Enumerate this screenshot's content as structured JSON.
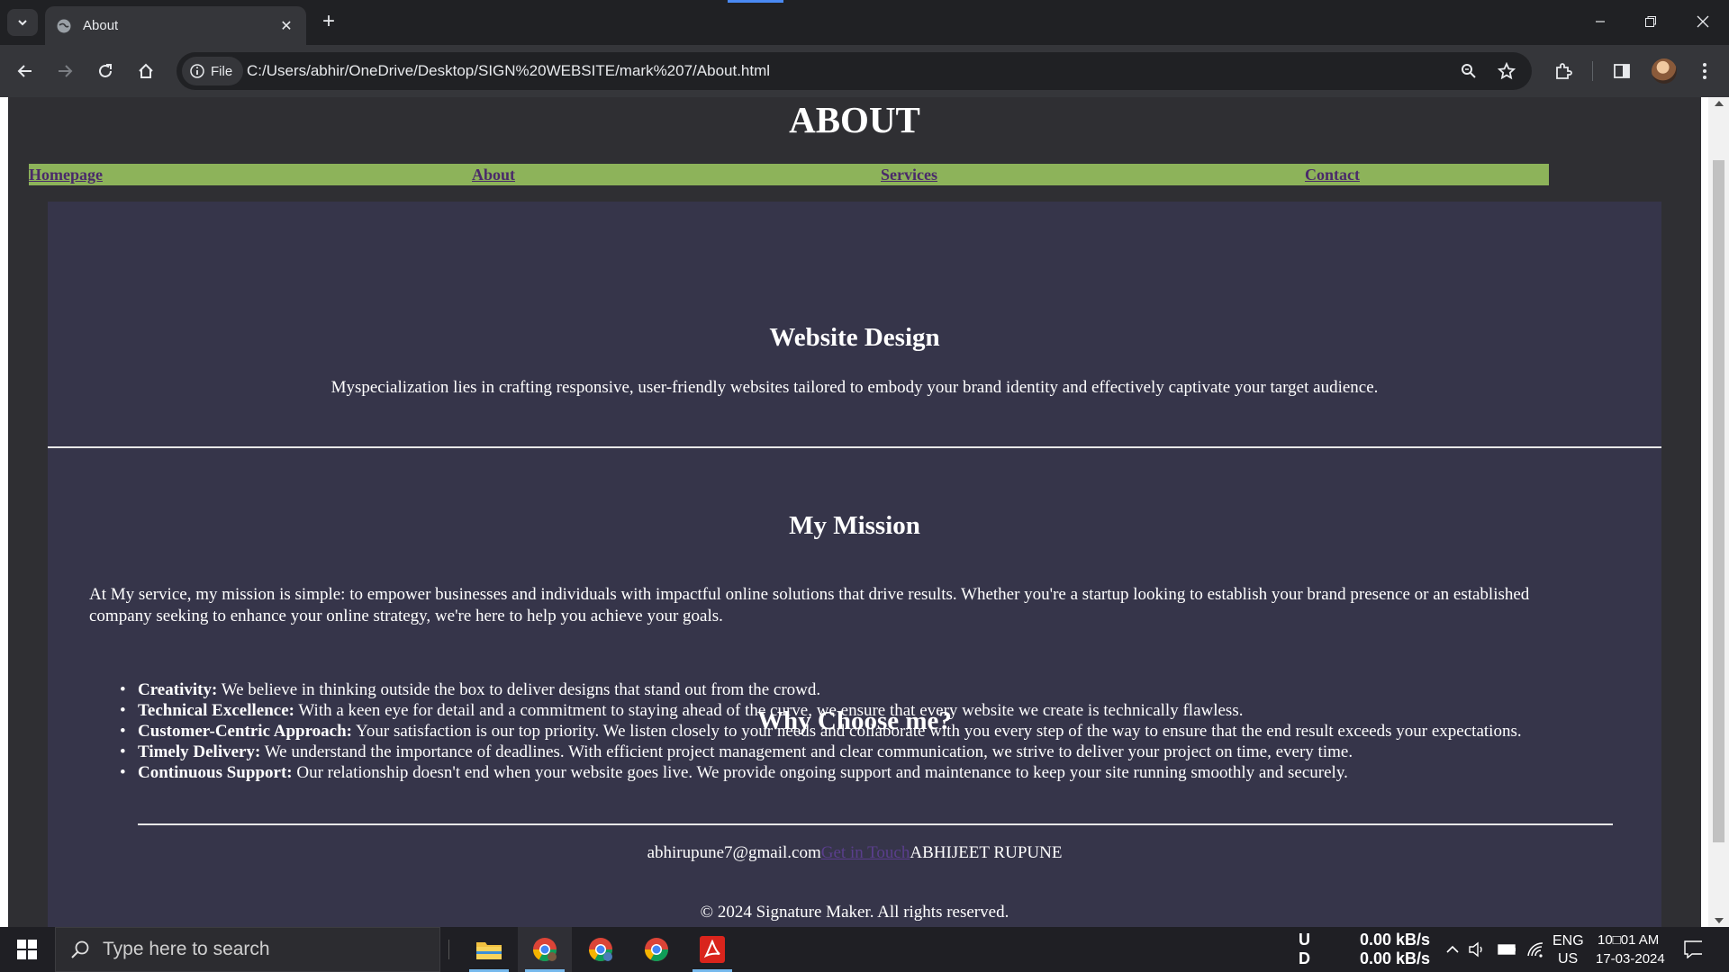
{
  "browser": {
    "tab": {
      "title": "About"
    },
    "address": {
      "chip_label": "File",
      "url": "C:/Users/abhir/OneDrive/Desktop/SIGN%20WEBSITE/mark%207/About.html"
    }
  },
  "page": {
    "title": "ABOUT",
    "nav": [
      "Homepage",
      "About",
      "Services",
      "Contact"
    ],
    "design": {
      "heading": "Website Design",
      "text": "Myspecialization lies in crafting responsive, user-friendly websites tailored to embody your brand identity and effectively captivate your target audience."
    },
    "mission": {
      "heading": "My Mission",
      "text": "At My service, my mission is simple: to empower businesses and individuals with impactful online solutions that drive results. Whether you're a startup looking to establish your brand presence or an established company seeking to enhance your online strategy, we're here to help you achieve your goals."
    },
    "why": {
      "heading": "Why Choose me?",
      "items": [
        {
          "label": "Creativity:",
          "text": " We believe in thinking outside the box to deliver designs that stand out from the crowd."
        },
        {
          "label": "Technical Excellence:",
          "text": " With a keen eye for detail and a commitment to staying ahead of the curve, we ensure that every website we create is technically flawless."
        },
        {
          "label": "Customer-Centric Approach:",
          "text": " Your satisfaction is our top priority. We listen closely to your needs and collaborate with you every step of the way to ensure that the end result exceeds your expectations."
        },
        {
          "label": "Timely Delivery:",
          "text": " We understand the importance of deadlines. With efficient project management and clear communication, we strive to deliver your project on time, every time."
        },
        {
          "label": "Continuous Support:",
          "text": " Our relationship doesn't end when your website goes live. We provide ongoing support and maintenance to keep your site running smoothly and securely."
        }
      ]
    },
    "footer": {
      "email": "abhirupune7@gmail.com",
      "link": "Get in Touch",
      "name": "ABHIJEET RUPUNE",
      "copyright": "© 2024 Signature Maker. All rights reserved."
    }
  },
  "taskbar": {
    "search_placeholder": "Type here to search",
    "net_labels": {
      "up": "U",
      "down": "D"
    },
    "net_up": "0.00 kB/s",
    "net_down": "0.00 kB/s",
    "lang": "ENG",
    "region": "US",
    "time": "10□01 AM",
    "date": "17-03-2024"
  },
  "colors": {
    "page_bg": "#2f2f33",
    "card_bg": "#36354a",
    "nav_bg": "#8db35a",
    "nav_link": "#4a2a6a"
  }
}
